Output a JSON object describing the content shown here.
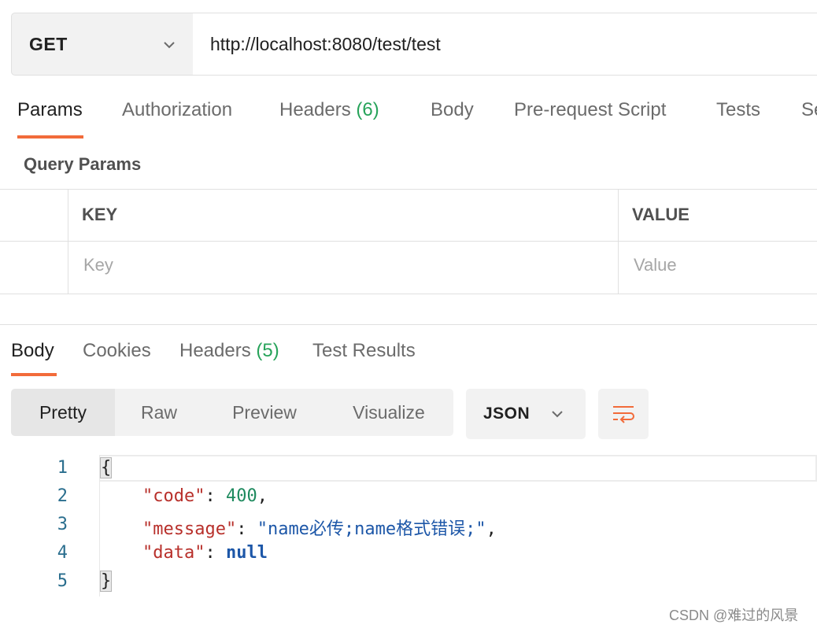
{
  "request": {
    "method": "GET",
    "method_icon": "chevron-down-icon",
    "url": "http://localhost:8080/test/test"
  },
  "request_tabs": [
    {
      "label": "Params",
      "count": "",
      "active": true
    },
    {
      "label": "Authorization",
      "count": "",
      "active": false
    },
    {
      "label": "Headers",
      "count": "(6)",
      "active": false
    },
    {
      "label": "Body",
      "count": "",
      "active": false
    },
    {
      "label": "Pre-request Script",
      "count": "",
      "active": false
    },
    {
      "label": "Tests",
      "count": "",
      "active": false
    },
    {
      "label": "Se",
      "count": "",
      "active": false
    }
  ],
  "query_params": {
    "title": "Query Params",
    "columns": [
      "KEY",
      "VALUE"
    ],
    "placeholders": {
      "key": "Key",
      "value": "Value"
    }
  },
  "response_tabs": [
    {
      "label": "Body",
      "count": "",
      "active": true
    },
    {
      "label": "Cookies",
      "count": "",
      "active": false
    },
    {
      "label": "Headers",
      "count": "(5)",
      "active": false
    },
    {
      "label": "Test Results",
      "count": "",
      "active": false
    }
  ],
  "view_modes": [
    {
      "label": "Pretty",
      "active": true
    },
    {
      "label": "Raw",
      "active": false
    },
    {
      "label": "Preview",
      "active": false
    },
    {
      "label": "Visualize",
      "active": false
    }
  ],
  "format": {
    "label": "JSON",
    "icon": "chevron-down-icon"
  },
  "wrap_icon": "wrap-lines-icon",
  "code": {
    "line_numbers": [
      "1",
      "2",
      "3",
      "4",
      "5"
    ],
    "open_brace": "{",
    "close_brace": "}",
    "key_code": "\"code\"",
    "val_code": "400",
    "key_message": "\"message\"",
    "val_message": "\"name必传;name格式错误;\"",
    "key_data": "\"data\"",
    "val_data": "null",
    "colon": ": ",
    "comma": ","
  },
  "colors": {
    "accent_underline": "#f26b3a",
    "count_green": "#27a35a",
    "json_key": "#b8302b",
    "json_number": "#1e8a5e",
    "json_string": "#1d57a8"
  },
  "watermark": "CSDN @难过的风景"
}
